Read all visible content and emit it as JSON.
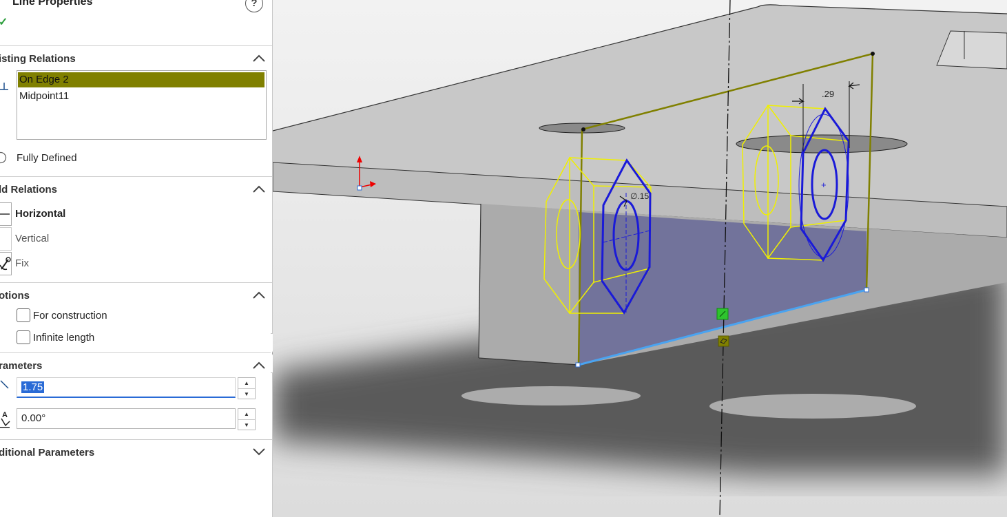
{
  "panel": {
    "title": "Line Properties",
    "help_symbol": "?",
    "ok_symbol": "✓",
    "existing_relations": {
      "header": "isting Relations",
      "items": [
        {
          "label": "On Edge 2",
          "selected": true
        },
        {
          "label": "Midpoint11",
          "selected": false
        }
      ],
      "status": "Fully Defined"
    },
    "add_relations": {
      "header": "ld Relations",
      "items": [
        "Horizontal",
        "Vertical",
        "Fix"
      ]
    },
    "options": {
      "header": "otions",
      "checkboxes": [
        {
          "label": "For construction",
          "checked": false
        },
        {
          "label": "Infinite length",
          "checked": false
        }
      ]
    },
    "parameters": {
      "header": "rameters",
      "length_value": "1.75",
      "angle_value": "0.00°"
    },
    "additional_parameters": {
      "header": "ditional Parameters"
    }
  },
  "viewport": {
    "dimensions": {
      "right_nut_dim": ".29",
      "left_nut_dim": "∅.15"
    }
  },
  "colors": {
    "selection_olive": "#808000",
    "sketch_blue": "#1a1ad8",
    "nut_yellow": "#f0f000",
    "selected_edge": "#4aa3f0",
    "plane_fill": "#6f709a"
  }
}
